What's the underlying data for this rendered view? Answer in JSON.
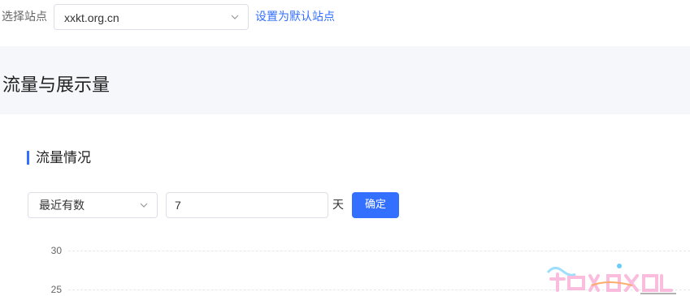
{
  "site_selector": {
    "label": "选择站点",
    "value": "xxkt.org.cn",
    "set_default_link": "设置为默认站点"
  },
  "page": {
    "title": "流量与展示量"
  },
  "traffic": {
    "section_title": "流量情况",
    "range_select_value": "最近有数",
    "days_value": "7",
    "days_unit": "天",
    "confirm_label": "确定"
  },
  "chart": {
    "y_ticks": [
      "30",
      "25"
    ]
  },
  "colors": {
    "accent": "#3370ff",
    "band": "#f5f7fa"
  }
}
